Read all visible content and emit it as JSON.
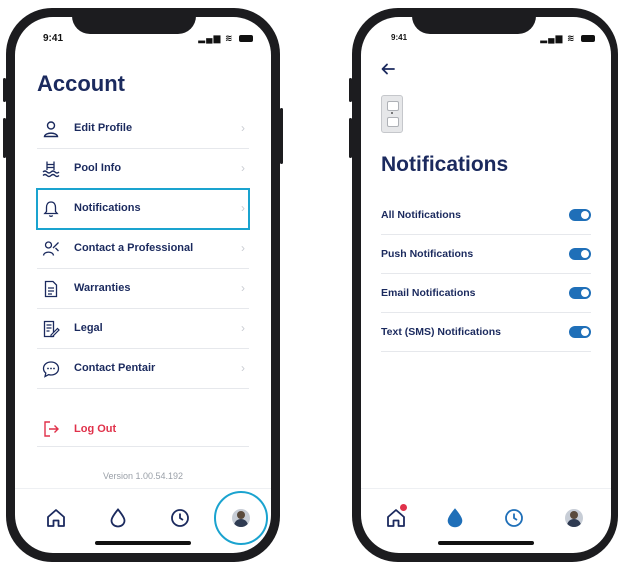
{
  "status_bar": {
    "time": "9:41"
  },
  "account_screen": {
    "title": "Account",
    "menu": [
      {
        "label": "Edit Profile",
        "icon": "person-icon",
        "selected": false
      },
      {
        "label": "Pool Info",
        "icon": "pool-icon",
        "selected": false
      },
      {
        "label": "Notifications",
        "icon": "bell-icon",
        "selected": true
      },
      {
        "label": "Contact a Professional",
        "icon": "professional-icon",
        "selected": false
      },
      {
        "label": "Warranties",
        "icon": "document-icon",
        "selected": false
      },
      {
        "label": "Legal",
        "icon": "legal-icon",
        "selected": false
      },
      {
        "label": "Contact Pentair",
        "icon": "chat-icon",
        "selected": false
      }
    ],
    "logout_label": "Log Out",
    "version": "Version 1.00.54.192"
  },
  "notifications_screen": {
    "back_icon": "back-arrow-icon",
    "device_image": "outlet-device-image",
    "title": "Notifications",
    "rows": [
      {
        "label": "All Notifications",
        "enabled": true
      },
      {
        "label": "Push Notifications",
        "enabled": true
      },
      {
        "label": "Email Notifications",
        "enabled": true
      },
      {
        "label": "Text (SMS) Notifications",
        "enabled": true
      }
    ]
  },
  "tab_bar": {
    "tabs": [
      {
        "icon": "home-icon"
      },
      {
        "icon": "water-drop-icon"
      },
      {
        "icon": "clock-icon"
      },
      {
        "icon": "avatar"
      }
    ]
  },
  "colors": {
    "navy": "#1b2a5e",
    "accent": "#1aa3cf",
    "toggle": "#1f6fb8",
    "danger": "#e0314a"
  }
}
